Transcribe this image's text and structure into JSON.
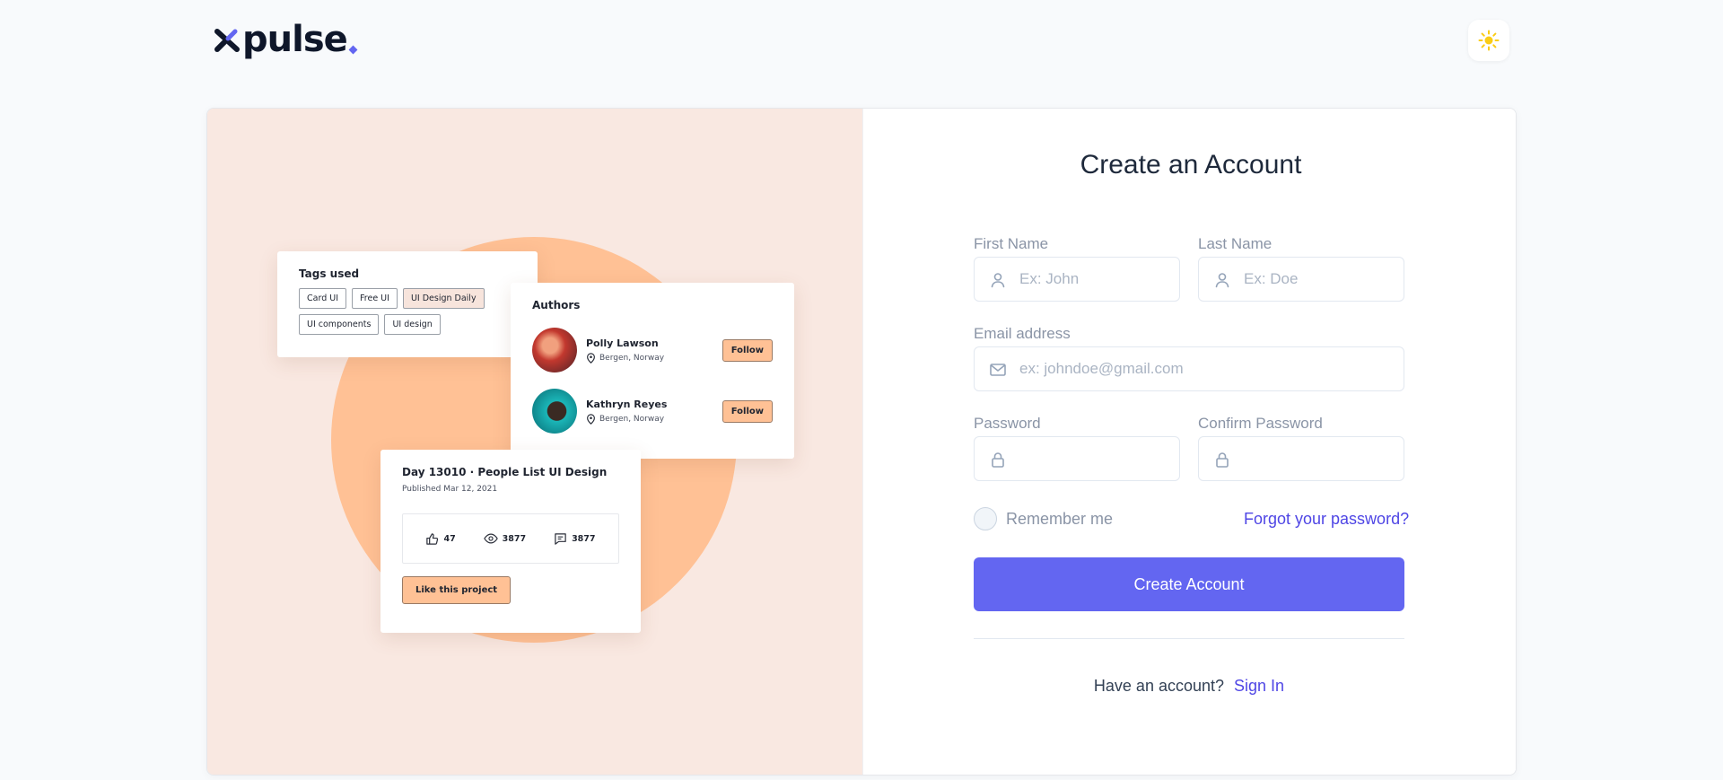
{
  "brand": {
    "name": "pulse"
  },
  "colors": {
    "primary": "#6366f1",
    "link": "#4f46e5",
    "panel": "#f9e8e1",
    "accent": "#ffc195"
  },
  "header": {
    "theme_icon": "sun-icon"
  },
  "illustration": {
    "tags_title": "Tags used",
    "tags": [
      "Card UI",
      "Free UI",
      "UI Design Daily",
      "UI components",
      "UI design"
    ],
    "authors_title": "Authors",
    "authors": [
      {
        "name": "Polly Lawson",
        "location": "Bergen, Norway",
        "button": "Follow"
      },
      {
        "name": "Kathryn Reyes",
        "location": "Bergen, Norway",
        "button": "Follow"
      }
    ],
    "project_title": "Day 13010 · People List UI Design",
    "project_published": "Published Mar 12, 2021",
    "stats": {
      "likes": "47",
      "views": "3877",
      "comments": "3877"
    },
    "like_button": "Like this project"
  },
  "form": {
    "title": "Create an Account",
    "first_name": {
      "label": "First Name",
      "placeholder": "Ex: John"
    },
    "last_name": {
      "label": "Last Name",
      "placeholder": "Ex: Doe"
    },
    "email": {
      "label": "Email address",
      "placeholder": "ex: johndoe@gmail.com"
    },
    "password": {
      "label": "Password",
      "placeholder": ""
    },
    "confirm_password": {
      "label": "Confirm Password",
      "placeholder": ""
    },
    "remember_me": "Remember me",
    "forgot_password": "Forgot your password?",
    "submit": "Create Account",
    "have_account": "Have an account?",
    "sign_in": "Sign In"
  }
}
